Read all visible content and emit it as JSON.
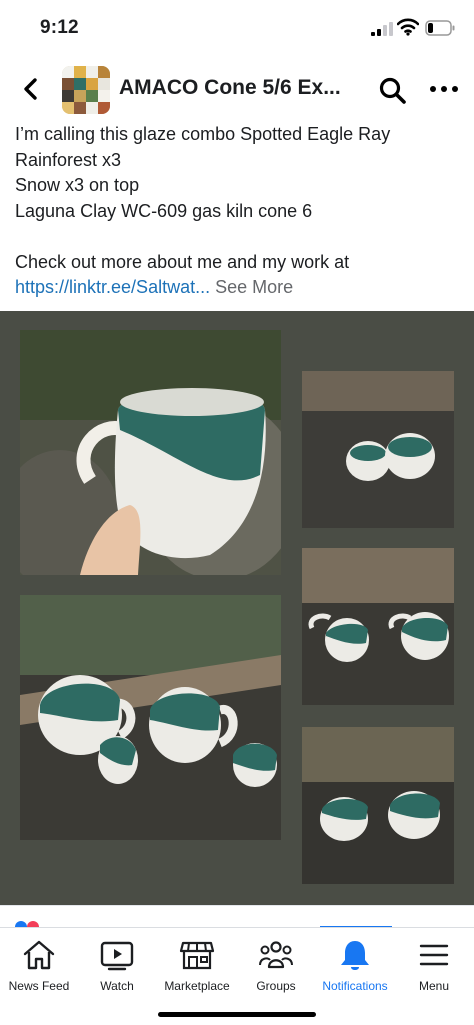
{
  "status_bar": {
    "time": "9:12"
  },
  "header": {
    "group_title": "AMACO Cone 5/6 Ex..."
  },
  "post": {
    "lines": [
      "I’m calling this glaze combo Spotted Eagle Ray",
      "Rainforest x3",
      "Snow x3 on top",
      "Laguna Clay WC-609 gas kiln cone 6",
      "",
      "Check out more about me and my work at"
    ],
    "link": "https://linktr.ee/Saltwat...",
    "see_more": " See More"
  },
  "photos": [
    {
      "alt": "hand holding white mug with spotted green glaze"
    },
    {
      "alt": "two small cups on rock"
    },
    {
      "alt": "three mugs on rock and driftwood"
    },
    {
      "alt": "two mugs on rock"
    },
    {
      "alt": "two mugs side by side on rock"
    }
  ],
  "tabs": [
    {
      "label": "News Feed",
      "icon": "home-icon",
      "active": false
    },
    {
      "label": "Watch",
      "icon": "video-play-icon",
      "active": false
    },
    {
      "label": "Marketplace",
      "icon": "storefront-icon",
      "active": false
    },
    {
      "label": "Groups",
      "icon": "groups-icon",
      "active": false
    },
    {
      "label": "Notifications",
      "icon": "bell-icon",
      "active": true
    },
    {
      "label": "Menu",
      "icon": "hamburger-menu-icon",
      "active": false
    }
  ],
  "colors": {
    "accent": "#1877f2",
    "link": "#1d72b8",
    "photo_bg": "#4a4d45",
    "glaze": "#2e6b63"
  }
}
